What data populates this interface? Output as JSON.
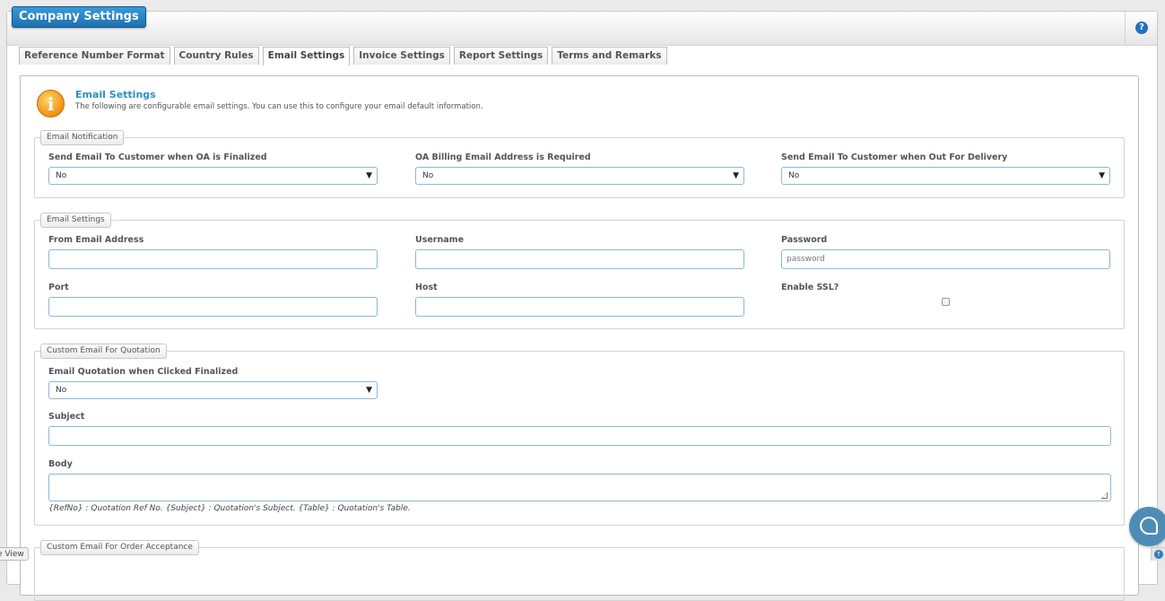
{
  "header": {
    "title": "Company Settings",
    "help_icon": "question-circle-icon",
    "help_glyph": "?"
  },
  "tabs": [
    {
      "label": "Reference Number Format",
      "active": false
    },
    {
      "label": "Country Rules",
      "active": false
    },
    {
      "label": "Email Settings",
      "active": true
    },
    {
      "label": "Invoice Settings",
      "active": false
    },
    {
      "label": "Report Settings",
      "active": false
    },
    {
      "label": "Terms and Remarks",
      "active": false
    }
  ],
  "intro": {
    "icon": "info-icon",
    "icon_glyph": "i",
    "heading": "Email Settings",
    "description": "The following are configurable email settings. You can use this to configure your email default information."
  },
  "email_notification": {
    "legend": "Email Notification",
    "send_on_finalized": {
      "label": "Send Email To Customer when OA is Finalized",
      "value": "No"
    },
    "billing_required": {
      "label": "OA Billing Email Address is Required",
      "value": "No"
    },
    "send_out_for_delivery": {
      "label": "Send Email To Customer when Out For Delivery",
      "value": "No"
    }
  },
  "email_settings": {
    "legend": "Email Settings",
    "from_email": {
      "label": "From Email Address",
      "value": ""
    },
    "username": {
      "label": "Username",
      "value": ""
    },
    "password": {
      "label": "Password",
      "placeholder": "password"
    },
    "port": {
      "label": "Port",
      "value": ""
    },
    "host": {
      "label": "Host",
      "value": ""
    },
    "ssl": {
      "label": "Enable SSL?",
      "checked": false
    }
  },
  "quotation_email": {
    "legend": "Custom Email For Quotation",
    "email_on_finalized": {
      "label": "Email Quotation when Clicked Finalized",
      "value": "No"
    },
    "subject": {
      "label": "Subject",
      "value": ""
    },
    "body": {
      "label": "Body",
      "value": ""
    },
    "hint": "{RefNo} : Quotation Ref No. {Subject} : Quotation's Subject. {Table} : Quotation's Table."
  },
  "order_acceptance_email": {
    "legend": "Custom Email For Order Acceptance"
  },
  "select_arrow": "▼",
  "left_tab": {
    "label": "e View"
  },
  "chat": {
    "icon": "chat-bubble-icon"
  },
  "scroll_top": {
    "icon": "arrow-up-icon",
    "glyph": "↑"
  },
  "colors": {
    "accent": "#2d8fc4",
    "title_button": "#1d6fb0",
    "input_border": "#8db8d6",
    "chat": "#4d8db5",
    "info_icon": "#f29b1d"
  }
}
